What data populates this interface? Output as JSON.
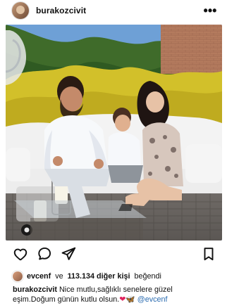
{
  "post": {
    "username": "burakozcivit",
    "more_label": "•••"
  },
  "likes": {
    "first": "evcenf",
    "conjunction": "ve",
    "count_text": "113.134 diğer kişi",
    "verb": "beğendi"
  },
  "caption": {
    "username": "burakozcivit",
    "text_line1": "Nice mutlu,sağlıklı senelere güzel",
    "text_line2": "eşim.Doğum günün kutlu olsun.",
    "heart": "❤",
    "butterfly": "🦋",
    "mention": "@evcenf"
  },
  "icons": {
    "like": "heart-outline-icon",
    "comment": "comment-icon",
    "share": "paper-plane-icon",
    "save": "bookmark-icon"
  }
}
